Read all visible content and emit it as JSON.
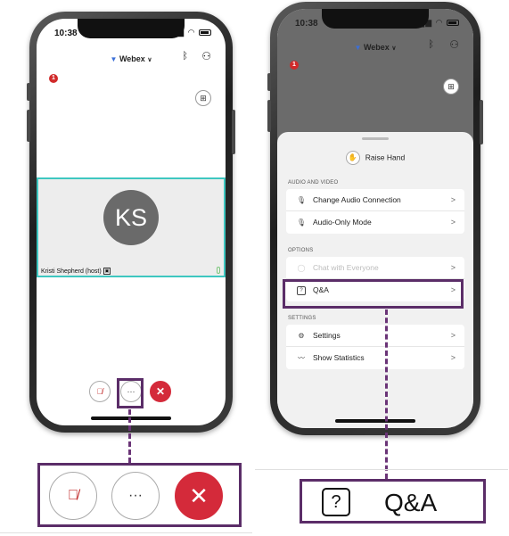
{
  "status": {
    "time": "10:38"
  },
  "header": {
    "app_name": "Webex",
    "caret": "∨",
    "badge_count": "1"
  },
  "left_phone": {
    "participant_initials": "KS",
    "participant_name": "Kristi Shepherd (host)",
    "controls": {
      "more_label": "···",
      "end_label": "✕"
    }
  },
  "right_phone": {
    "raise_hand": "Raise Hand",
    "sections": {
      "audio_video": "AUDIO AND VIDEO",
      "options": "OPTIONS",
      "settings": "SETTINGS"
    },
    "items": {
      "change_audio": "Change Audio Connection",
      "audio_only": "Audio-Only Mode",
      "chat": "Chat with Everyone",
      "qa": "Q&A",
      "settings": "Settings",
      "statistics": "Show Statistics"
    },
    "chevron": ">"
  },
  "callouts": {
    "controls": {
      "more_label": "···",
      "end_label": "✕"
    },
    "qa": {
      "icon": "?",
      "label": "Q&A"
    }
  },
  "colors": {
    "highlight": "#5b2d68",
    "end_call": "#d42a3a",
    "video_border": "#3ec7c0",
    "avatar": "#6a6a6a"
  },
  "icons": [
    "bluetooth-icon",
    "participants-icon",
    "layout-icon",
    "mute-icon",
    "hand-icon",
    "audio-icon",
    "audio-only-icon",
    "chat-icon",
    "question-icon",
    "gear-icon",
    "statistics-icon",
    "chevron-right-icon",
    "close-icon"
  ]
}
